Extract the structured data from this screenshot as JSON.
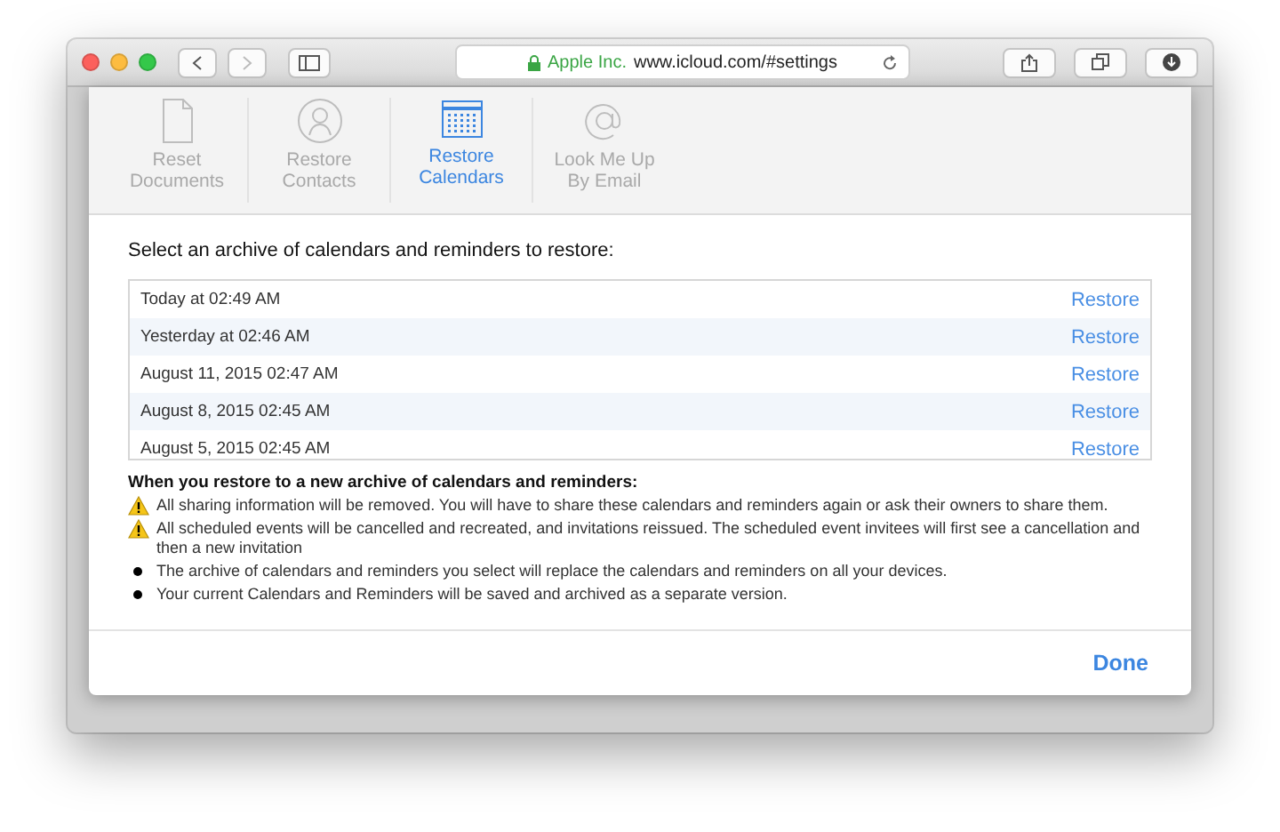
{
  "browser": {
    "address": {
      "owner": "Apple Inc.",
      "url": "www.icloud.com/#settings"
    }
  },
  "tabs": [
    {
      "kind": "document",
      "label": "Reset Documents",
      "selected": false
    },
    {
      "kind": "person",
      "label": "Restore Contacts",
      "selected": false
    },
    {
      "kind": "calendar",
      "label": "Restore Calendars",
      "selected": true
    },
    {
      "kind": "at",
      "label": "Look Me Up By Email",
      "selected": false
    }
  ],
  "prompt": "Select an archive of calendars and reminders to restore:",
  "archives": [
    {
      "date": "Today at 02:49 AM",
      "action": "Restore"
    },
    {
      "date": "Yesterday at 02:46 AM",
      "action": "Restore"
    },
    {
      "date": "August 11, 2015 02:47 AM",
      "action": "Restore"
    },
    {
      "date": "August 8, 2015 02:45 AM",
      "action": "Restore"
    },
    {
      "date": "August 5, 2015 02:45 AM",
      "action": "Restore"
    }
  ],
  "notes_title": "When you restore to a new archive of calendars and reminders:",
  "notes": [
    {
      "kind": "warning",
      "text": "All sharing information will be removed. You will have to share these calendars and reminders again or ask their owners to share them."
    },
    {
      "kind": "warning",
      "text": "All scheduled events will be cancelled and recreated, and invitations reissued. The scheduled event invitees will first see a cancellation and then a new invitation"
    },
    {
      "kind": "bullet",
      "text": "The archive of calendars and reminders you select will replace the calendars and reminders on all your devices."
    },
    {
      "kind": "bullet",
      "text": "Your current Calendars and Reminders will be saved and archived as a separate version."
    }
  ],
  "done": "Done"
}
